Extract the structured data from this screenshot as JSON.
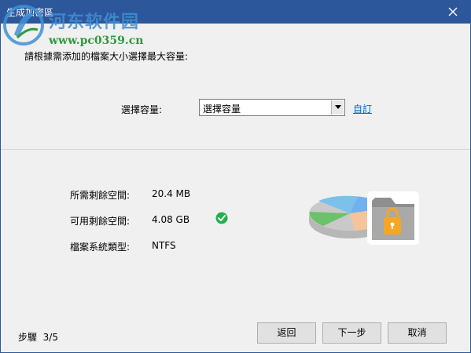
{
  "window": {
    "title": "生成加密區"
  },
  "watermark": {
    "site_name": "河东软件园",
    "url": "www.pc0359.cn"
  },
  "instruction": "請根據需添加的檔案大小選擇最大容量:",
  "capacity": {
    "label": "選擇容量:",
    "selected": "選擇容量",
    "custom_link": "自訂"
  },
  "info": {
    "required_label": "所需剩餘空間:",
    "required_value": "20.4 MB",
    "available_label": "可用剩餘空間:",
    "available_value": "4.08 GB",
    "filesystem_label": "檔案系統類型:",
    "filesystem_value": "NTFS"
  },
  "footer": {
    "step_label": "步驟",
    "step_value": "3/5",
    "back_label": "返回",
    "next_label": "下一步",
    "cancel_label": "取消"
  },
  "colors": {
    "titlebar": "#2c579a",
    "link": "#0066cc",
    "check_green": "#22b14c",
    "lock_orange": "#f5a623"
  }
}
